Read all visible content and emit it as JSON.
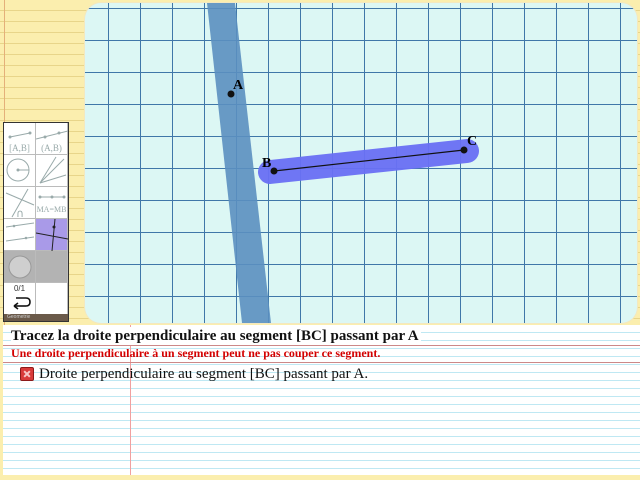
{
  "points": {
    "a_label": "A",
    "b_label": "B",
    "c_label": "C"
  },
  "toolbar": {
    "segment_label": "[A,B]",
    "line_label": "(A,B)",
    "equal_label": "MA=MB",
    "counter": "0/1",
    "undo_icon": "undo-arrow-icon",
    "footer_text": "Geometrie"
  },
  "exercise": {
    "title": "Tracez la droite perpendiculaire au segment [BC] passant par A",
    "warning": "Une droite perpendiculaire à un segment peut ne pas couper ce segment.",
    "item_text": "Droite perpendiculaire au segment [BC] passant par A.",
    "item_status_icon": "fail-icon"
  },
  "colors": {
    "line_drawn": "#5b8fc0",
    "segment_highlight": "#6a70f5",
    "warning": "#d40000",
    "grid": "#3f77a8",
    "canvas_bg": "#dcf7f4"
  }
}
